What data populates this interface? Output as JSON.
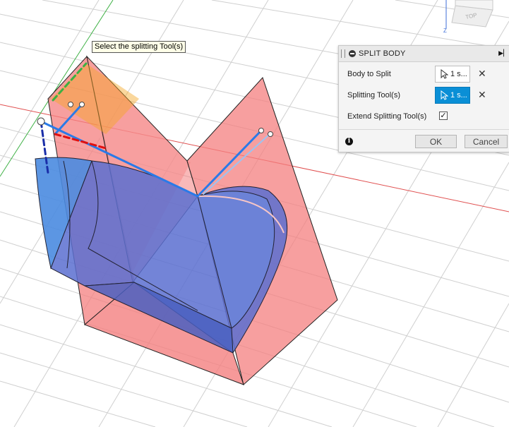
{
  "tooltip": {
    "text": "Select the splitting Tool(s)"
  },
  "panel": {
    "title": "SPLIT BODY",
    "rows": [
      {
        "label": "Body to Split",
        "value": "1 s..."
      },
      {
        "label": "Splitting Tool(s)",
        "value": "1 s..."
      },
      {
        "label": "Extend Splitting Tool(s)",
        "checked": "✓"
      }
    ],
    "ok_label": "OK",
    "cancel_label": "Cancel"
  },
  "viewcube": {
    "face_label": "TOP",
    "axis_label": "Z"
  },
  "colors": {
    "splitting_tool": "#f47f7f",
    "body": "#5b7fd6",
    "selected": "#0a8fd6",
    "highlight": "#f5a623"
  },
  "icons": [
    "collapse-icon",
    "cursor-icon",
    "clear-icon",
    "info-icon",
    "expand-icon"
  ]
}
